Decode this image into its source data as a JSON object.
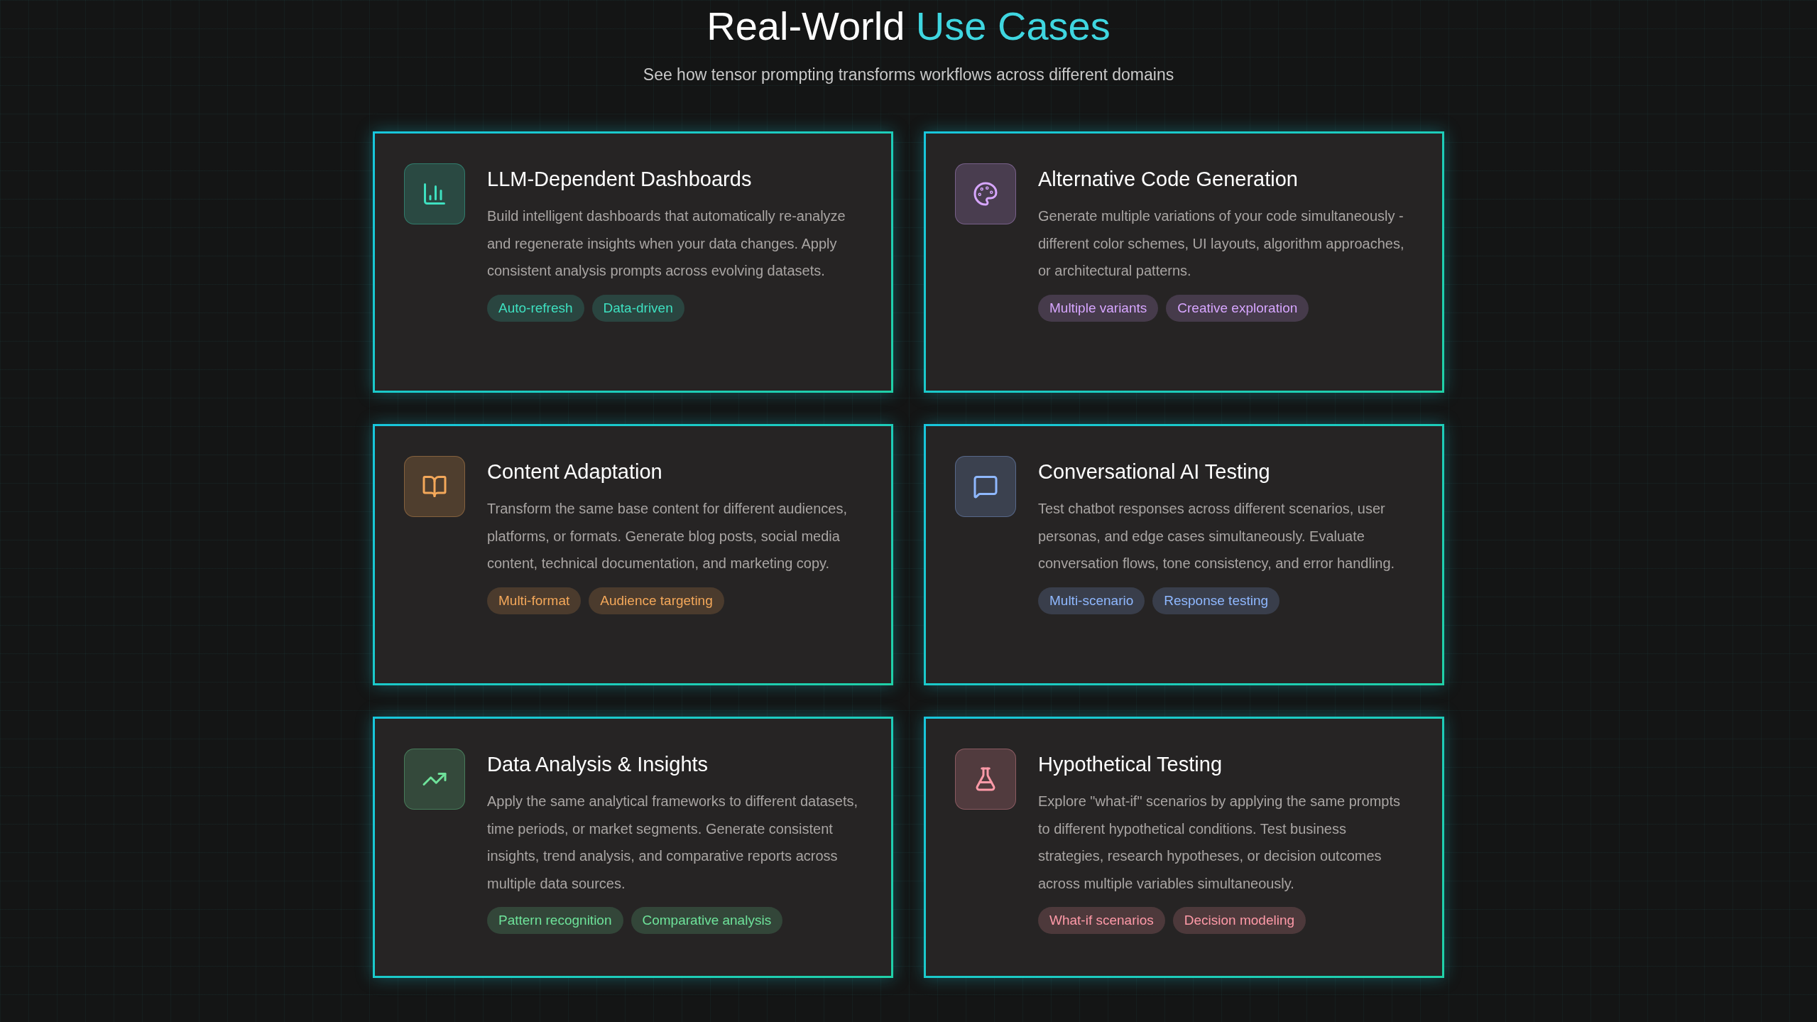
{
  "heading": {
    "title": "Real-World",
    "highlight": "Use Cases",
    "subtitle": "See how tensor prompting transforms workflows across different domains"
  },
  "cards": [
    {
      "title": "LLM-Dependent Dashboards",
      "description": "Build intelligent dashboards that automatically re-analyze and regenerate insights when your data changes. Apply consistent analysis prompts across evolving datasets.",
      "color": "#3ee0c0",
      "tags": [
        "Auto-refresh",
        "Data-driven"
      ]
    },
    {
      "title": "Alternative Code Generation",
      "description": "Generate multiple variations of your code simultaneously - different color schemes, UI layouts, algorithm approaches, or architectural patterns.",
      "color": "#d7a6ff",
      "tags": [
        "Multiple variants",
        "Creative exploration"
      ]
    },
    {
      "title": "Content Adaptation",
      "description": "Transform the same base content for different audiences, platforms, or formats. Generate blog posts, social media content, technical documentation, and marketing copy.",
      "color": "#f4a85a",
      "tags": [
        "Multi-format",
        "Audience targeting"
      ]
    },
    {
      "title": "Conversational AI Testing",
      "description": "Test chatbot responses across different scenarios, user personas, and edge cases simultaneously. Evaluate conversation flows, tone consistency, and error handling.",
      "color": "#8fb8ff",
      "tags": [
        "Multi-scenario",
        "Response testing"
      ]
    },
    {
      "title": "Data Analysis & Insights",
      "description": "Apply the same analytical frameworks to different datasets, time periods, or market segments. Generate consistent insights, trend analysis, and comparative reports across multiple data sources.",
      "color": "#6ee29a",
      "tags": [
        "Pattern recognition",
        "Comparative analysis"
      ]
    },
    {
      "title": "Hypothetical Testing",
      "description": "Explore \"what-if\" scenarios by applying the same prompts to different hypothetical conditions. Test business strategies, research hypotheses, or decision outcomes across multiple variables simultaneously.",
      "color": "#ff9aa8",
      "tags": [
        "What-if scenarios",
        "Decision modeling"
      ]
    }
  ]
}
